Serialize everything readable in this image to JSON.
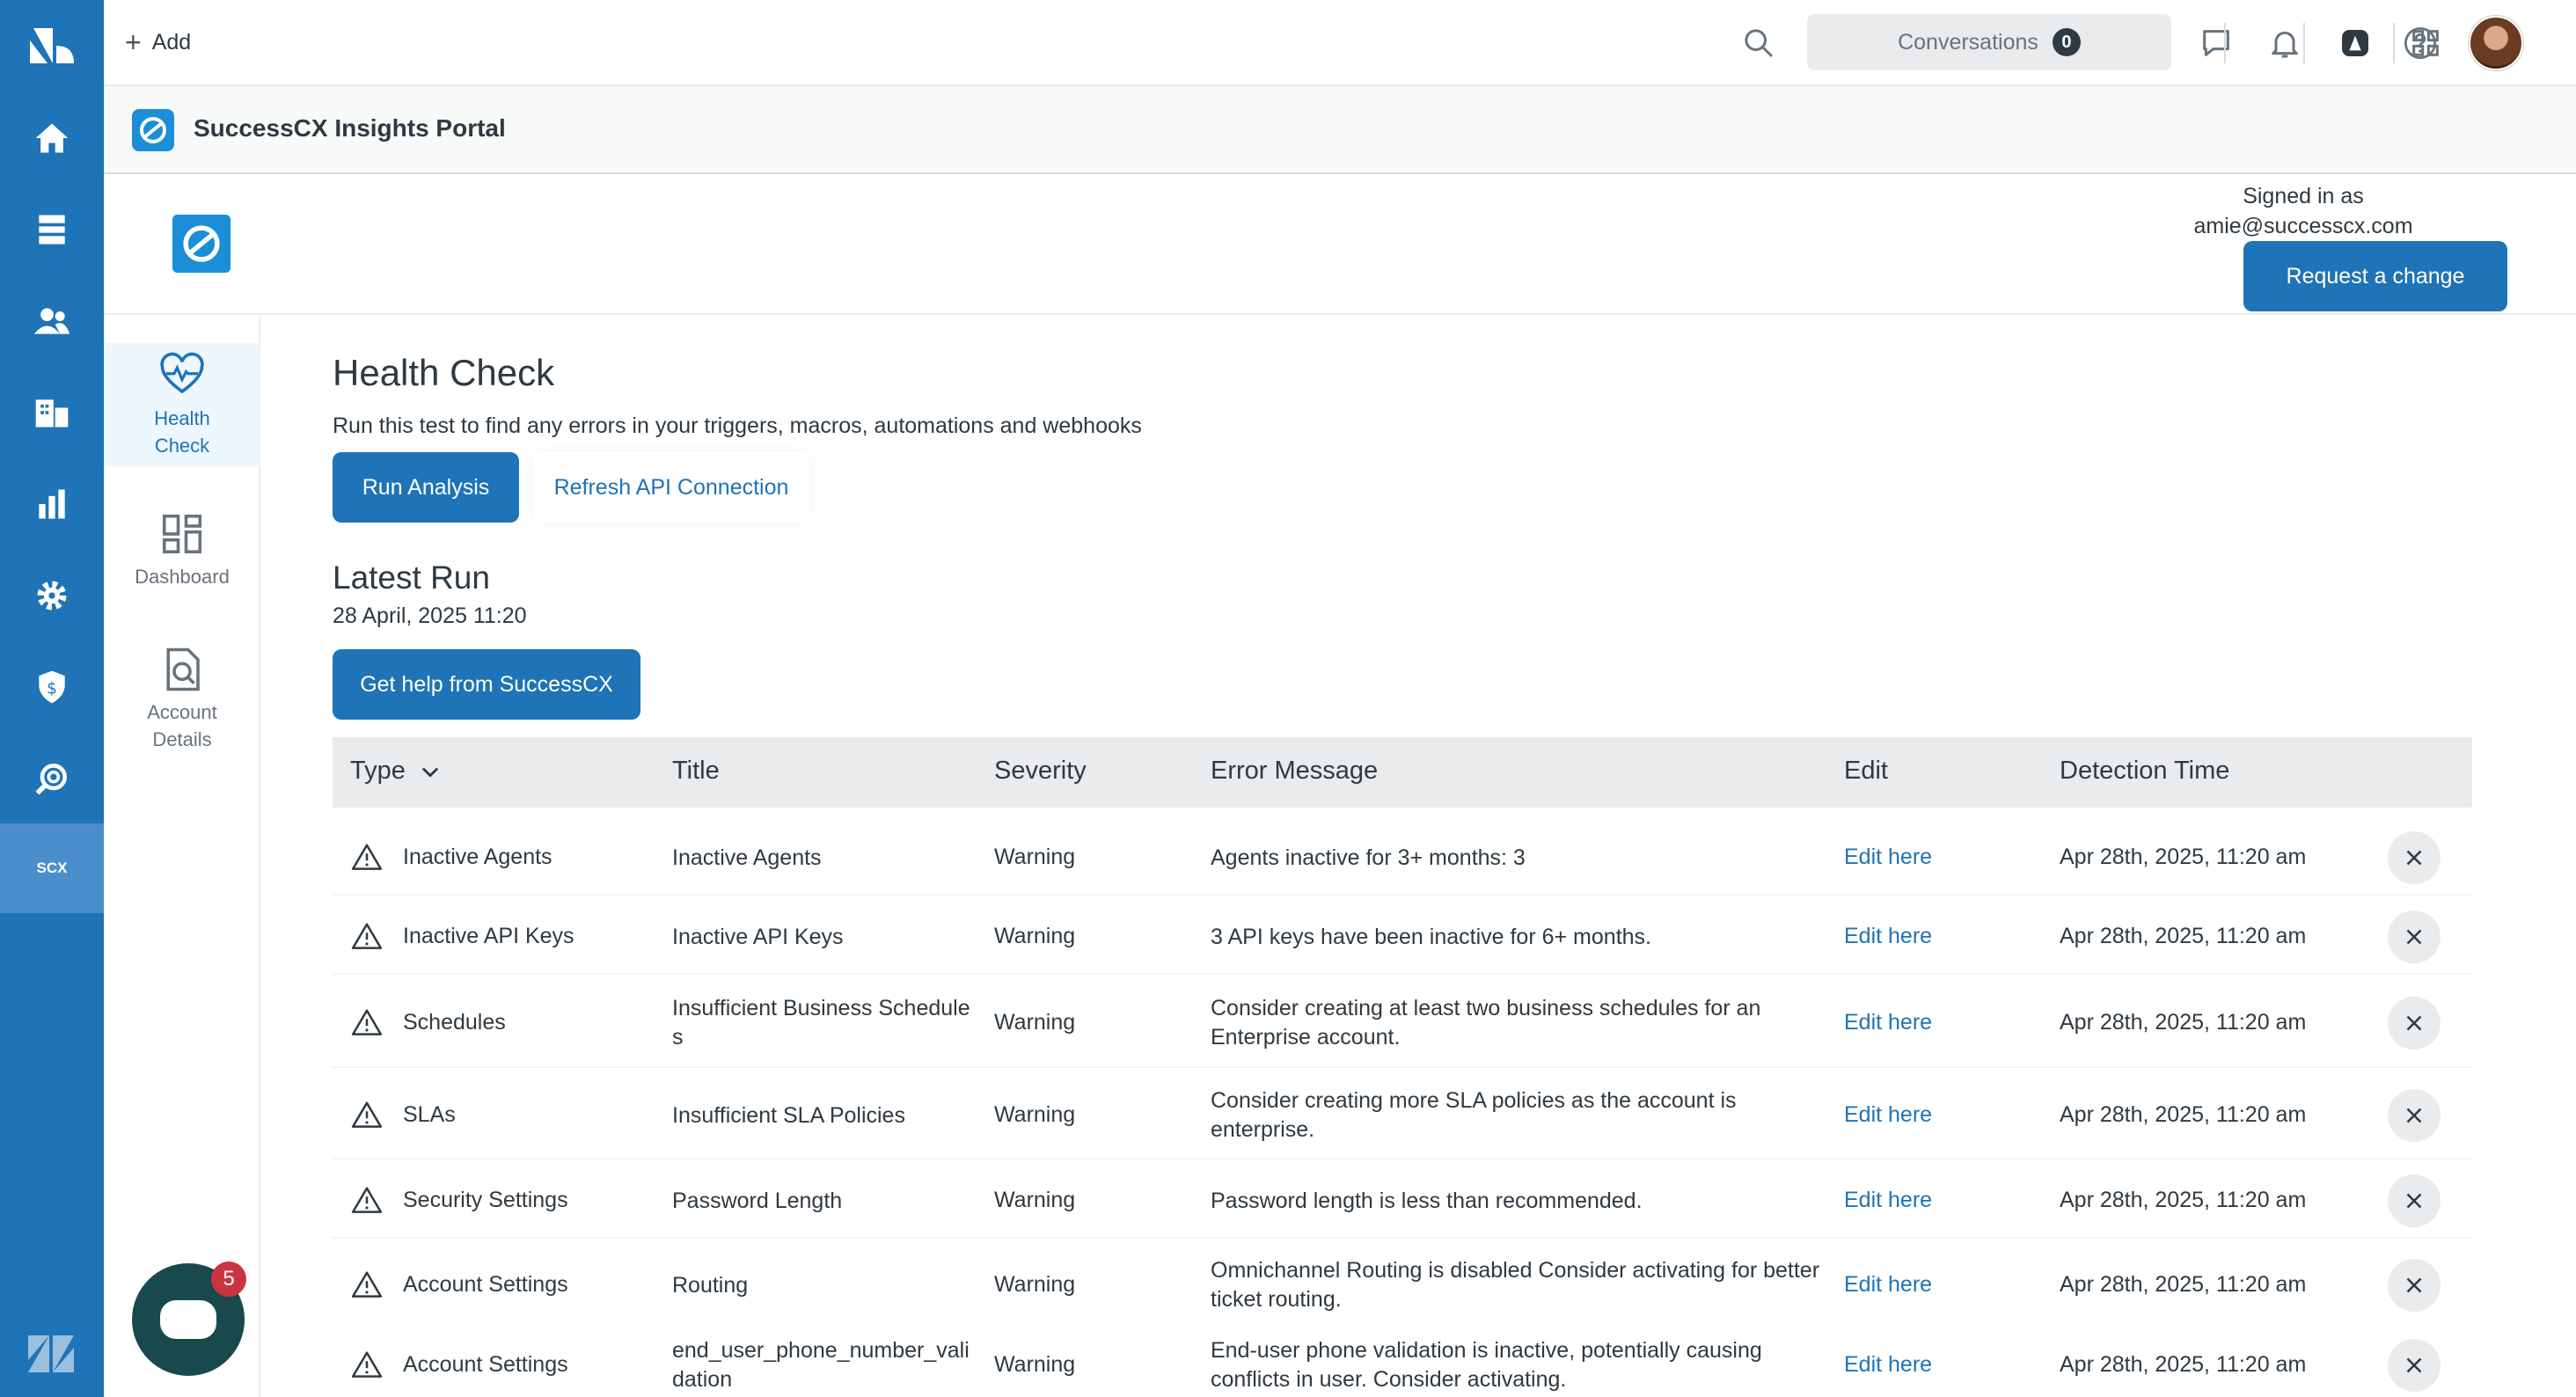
{
  "topbar": {
    "add_label": "Add",
    "conversations_label": "Conversations",
    "conversations_count": "0"
  },
  "app": {
    "title": "SuccessCX Insights Portal",
    "signed_in_label": "Signed in as",
    "signed_in_email": "amie@successcx.com",
    "request_change_label": "Request a change"
  },
  "gnav": {
    "scx_label": "SCX"
  },
  "sidebar": {
    "items": [
      {
        "label": "Health Check"
      },
      {
        "label": "Dashboard"
      },
      {
        "label": "Account Details"
      }
    ]
  },
  "health": {
    "title": "Health Check",
    "subtitle": "Run this test to find any errors in your triggers, macros, automations and webhooks",
    "run_label": "Run Analysis",
    "refresh_label": "Refresh API Connection"
  },
  "latest": {
    "title": "Latest Run",
    "date": "28 April, 2025 11:20",
    "help_label": "Get help from SuccessCX"
  },
  "table": {
    "headers": {
      "type": "Type",
      "title": "Title",
      "severity": "Severity",
      "message": "Error Message",
      "edit": "Edit",
      "time": "Detection Time"
    },
    "rows": [
      {
        "type": "Inactive Agents",
        "title": "Inactive Agents",
        "severity": "Warning",
        "message": "Agents inactive for 3+ months: 3",
        "edit": "Edit here",
        "time": "Apr 28th, 2025, 11:20 am"
      },
      {
        "type": "Inactive API Keys",
        "title": "Inactive API Keys",
        "severity": "Warning",
        "message": "3 API keys have been inactive for 6+ months.",
        "edit": "Edit here",
        "time": "Apr 28th, 2025, 11:20 am"
      },
      {
        "type": "Schedules",
        "title": "Insufficient Business Schedules",
        "severity": "Warning",
        "message": "Consider creating at least two business schedules for an Enterprise account.",
        "edit": "Edit here",
        "time": "Apr 28th, 2025, 11:20 am"
      },
      {
        "type": "SLAs",
        "title": "Insufficient SLA Policies",
        "severity": "Warning",
        "message": "Consider creating more SLA policies as the account is enterprise.",
        "edit": "Edit here",
        "time": "Apr 28th, 2025, 11:20 am"
      },
      {
        "type": "Security Settings",
        "title": "Password Length",
        "severity": "Warning",
        "message": "Password length is less than recommended.",
        "edit": "Edit here",
        "time": "Apr 28th, 2025, 11:20 am"
      },
      {
        "type": "Account Settings",
        "title": "Routing",
        "severity": "Warning",
        "message": "Omnichannel Routing is disabled Consider activating for better ticket routing.",
        "edit": "Edit here",
        "time": "Apr 28th, 2025, 11:20 am"
      },
      {
        "type": "Account Settings",
        "title": "end_user_phone_number_validation",
        "severity": "Warning",
        "message": "End-user phone validation is inactive, potentially causing conflicts in user. Consider activating.",
        "edit": "Edit here",
        "time": "Apr 28th, 2025, 11:20 am"
      }
    ]
  },
  "chat": {
    "count": "5"
  },
  "colors": {
    "brand_blue": "#1f73b7",
    "nav_bg": "#1f73b7",
    "chat_bg": "#17494d",
    "badge_red": "#cc3340"
  }
}
